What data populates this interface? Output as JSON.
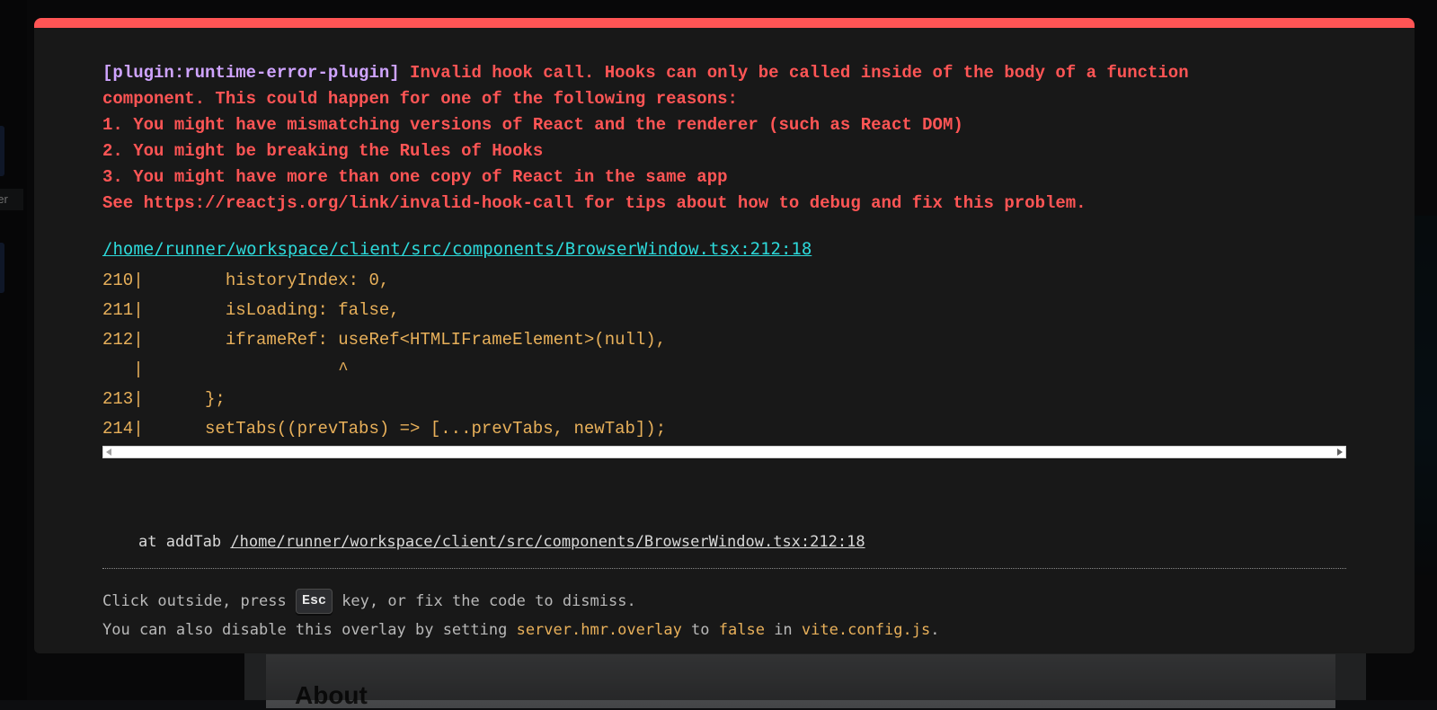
{
  "error": {
    "plugin": "[plugin:runtime-error-plugin]",
    "message": " Invalid hook call. Hooks can only be called inside of the body of a function\ncomponent. This could happen for one of the following reasons:\n1. You might have mismatching versions of React and the renderer (such as React DOM)\n2. You might be breaking the Rules of Hooks\n3. You might have more than one copy of React in the same app\nSee https://reactjs.org/link/invalid-hook-call for tips about how to debug and fix this problem.",
    "file": "/home/runner/workspace/client/src/components/BrowserWindow.tsx:212:18",
    "frame_lines": [
      "210|        historyIndex: 0,",
      "211|        isLoading: false,",
      "212|        iframeRef: useRef<HTMLIFrameElement>(null),",
      "   |                   ^",
      "213|      };",
      "214|      setTabs((prevTabs) => [...prevTabs, newTab]);"
    ],
    "stack_prefix": "at addTab ",
    "stack_file": "/home/runner/workspace/client/src/components/BrowserWindow.tsx:212:18"
  },
  "tip": {
    "line1_before": "Click outside, press ",
    "esc_key": "Esc",
    "line1_after": " key, or fix the code to dismiss.",
    "line2_before": "You can also disable this overlay by setting ",
    "setting": "server.hmr.overlay",
    "line2_to": " to ",
    "value": "false",
    "line2_in": " in ",
    "config_file": "vite.config.js",
    "line2_end": "."
  },
  "background": {
    "tooltip_text": "ger",
    "heading": "About"
  },
  "colors": {
    "error_red": "#ff5555",
    "plugin_purple": "#cfa4ff",
    "link_cyan": "#2dd9da",
    "code_yellow": "#e8b05a",
    "window_bg": "#181818"
  }
}
